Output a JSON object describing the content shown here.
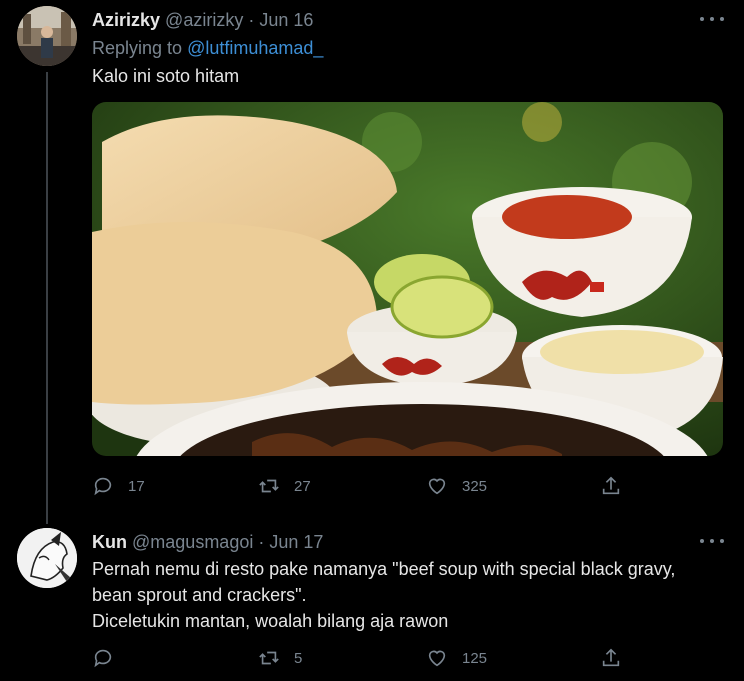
{
  "tweets": [
    {
      "name": "Azirizky",
      "handle": "@azirizky",
      "separator": "·",
      "date": "Jun 16",
      "replying_prefix": "Replying to ",
      "replying_to": "@lutfimuhamad_",
      "lines": [
        "Kalo ini soto hitam"
      ],
      "stats": {
        "replies": "17",
        "retweets": "27",
        "likes": "325"
      },
      "image_alt": "soto hitam with crackers, lime, sambal and bean sprouts"
    },
    {
      "name": "Kun",
      "handle": "@magusmagoi",
      "separator": "·",
      "date": "Jun 17",
      "lines": [
        "Pernah nemu di resto pake namanya \"beef soup with special black gravy,",
        "bean sprout and crackers\".",
        "Diceletukin mantan, woalah bilang aja rawon"
      ],
      "stats": {
        "replies": "",
        "retweets": "5",
        "likes": "125"
      }
    }
  ],
  "icons": [
    "reply-icon",
    "retweet-icon",
    "like-icon",
    "share-icon",
    "more-icon"
  ],
  "colors": {
    "background": "#000000",
    "muted": "#7a8590",
    "link": "#3d8fd6",
    "text": "#e6e6e6"
  }
}
